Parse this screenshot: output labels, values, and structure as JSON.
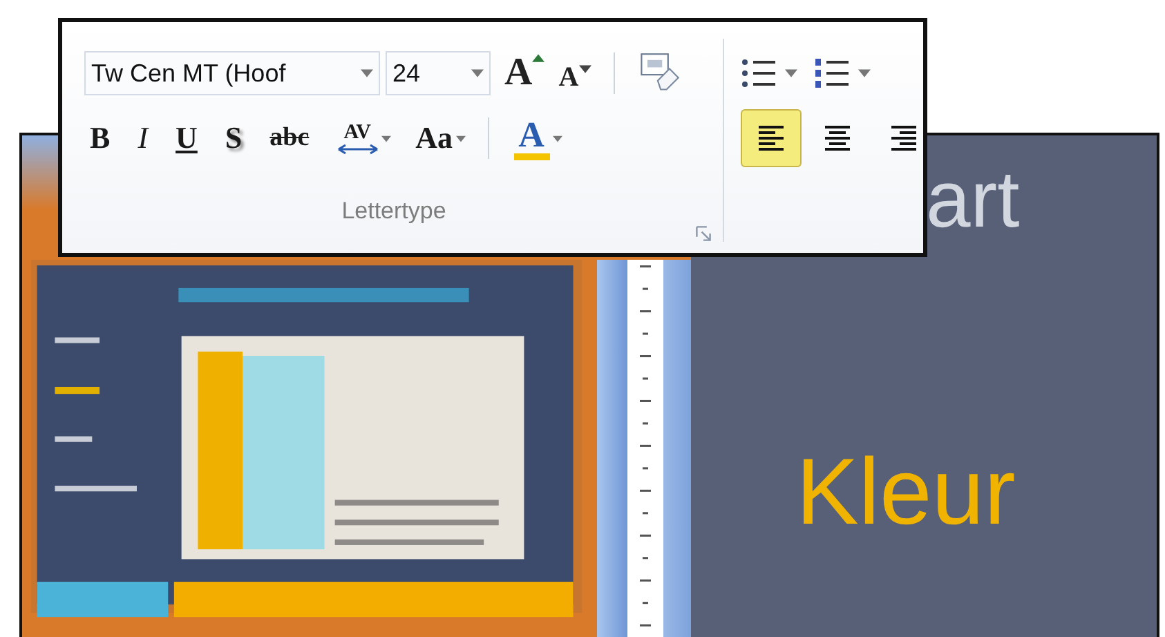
{
  "ribbon": {
    "font_box": {
      "value": "Tw Cen MT (Hoof"
    },
    "size_box": {
      "value": "24"
    },
    "top_tools": [
      {
        "kind": "grow",
        "glyph": "A"
      },
      {
        "kind": "shrink",
        "glyph": "A"
      },
      {
        "kind": "clear"
      }
    ],
    "format_buttons": [
      {
        "kind": "bold",
        "glyph": "B",
        "dropdown": false
      },
      {
        "kind": "italic",
        "glyph": "I",
        "dropdown": false
      },
      {
        "kind": "underline",
        "glyph": "U",
        "dropdown": false
      },
      {
        "kind": "shadow",
        "glyph": "S",
        "dropdown": false
      },
      {
        "kind": "strike",
        "glyph": "abc",
        "dropdown": false
      },
      {
        "kind": "spacing",
        "glyph": "AV",
        "dropdown": true
      },
      {
        "kind": "case",
        "glyph": "Aa",
        "dropdown": true
      },
      {
        "kind": "color",
        "glyph": "A",
        "dropdown": true
      }
    ],
    "group_label": "Lettertype",
    "list_buttons": [
      {
        "kind": "bullets"
      },
      {
        "kind": "numbering"
      }
    ],
    "align_buttons": [
      {
        "kind": "left",
        "selected": true
      },
      {
        "kind": "center",
        "selected": false
      },
      {
        "kind": "right",
        "selected": false
      }
    ]
  },
  "slide": {
    "title": "art",
    "text": "Kleur"
  }
}
